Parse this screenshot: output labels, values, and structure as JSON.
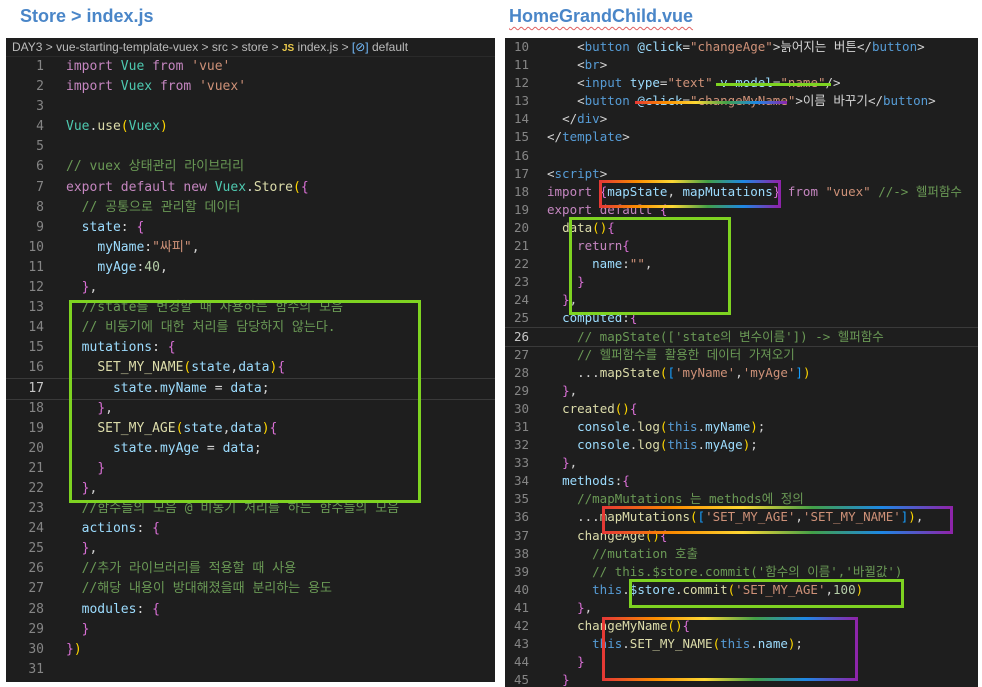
{
  "headings": {
    "left": "Store > index.js",
    "right": "HomeGrandChild.vue"
  },
  "breadcrumb": {
    "folder1": "DAY3",
    "folder2": "vue-starting-template-vuex",
    "folder3": "src",
    "folder4": "store",
    "js_badge": "JS",
    "file": "index.js",
    "symbol_badge": "[⊘]",
    "symbol": "default"
  },
  "colors": {
    "editor_bg": "#1e1e1e",
    "box_green": "#7ed321",
    "heading_blue": "#4a86c8"
  },
  "left_lines": [
    {
      "n": "1",
      "t": "import Vue from 'vue'"
    },
    {
      "n": "2",
      "t": "import Vuex from 'vuex'"
    },
    {
      "n": "3",
      "t": ""
    },
    {
      "n": "4",
      "t": "Vue.use(Vuex)"
    },
    {
      "n": "5",
      "t": ""
    },
    {
      "n": "6",
      "t": "// vuex 상태관리 라이브러리"
    },
    {
      "n": "7",
      "t": "export default new Vuex.Store({"
    },
    {
      "n": "8",
      "t": "  // 공통으로 관리할 데이터"
    },
    {
      "n": "9",
      "t": "  state: {"
    },
    {
      "n": "10",
      "t": "    myName:\"싸피\","
    },
    {
      "n": "11",
      "t": "    myAge:40,"
    },
    {
      "n": "12",
      "t": "  },"
    },
    {
      "n": "13",
      "t": "  //state를 변경할 때 사용하는 함수의 모음"
    },
    {
      "n": "14",
      "t": "  // 비동기에 대한 처리를 담당하지 않는다."
    },
    {
      "n": "15",
      "t": "  mutations: {"
    },
    {
      "n": "16",
      "t": "    SET_MY_NAME(state,data){"
    },
    {
      "n": "17",
      "t": "      state.myName = data;"
    },
    {
      "n": "18",
      "t": "    },"
    },
    {
      "n": "19",
      "t": "    SET_MY_AGE(state,data){"
    },
    {
      "n": "20",
      "t": "      state.myAge = data;"
    },
    {
      "n": "21",
      "t": "    }"
    },
    {
      "n": "22",
      "t": "  },"
    },
    {
      "n": "23",
      "t": "  //함수들의 모음 @ 비동기 처리를 하는 함수들의 모음"
    },
    {
      "n": "24",
      "t": "  actions: {"
    },
    {
      "n": "25",
      "t": "  },"
    },
    {
      "n": "26",
      "t": "  //추가 라이브러리를 적용할 때 사용"
    },
    {
      "n": "27",
      "t": "  //해당 내용이 방대해졌을때 분리하는 용도"
    },
    {
      "n": "28",
      "t": "  modules: {"
    },
    {
      "n": "29",
      "t": "  }"
    },
    {
      "n": "30",
      "t": "})"
    },
    {
      "n": "31",
      "t": ""
    }
  ],
  "right_lines": [
    {
      "n": "10",
      "t": "    <button @click=\"changeAge\">늙어지는 버튼</button>"
    },
    {
      "n": "11",
      "t": "    <br>"
    },
    {
      "n": "12",
      "t": "    <input type=\"text\" v-model=\"name\"/>"
    },
    {
      "n": "13",
      "t": "    <button @click=\"changeMyName\">이름 바꾸기</button>"
    },
    {
      "n": "14",
      "t": "  </div>"
    },
    {
      "n": "15",
      "t": "</template>"
    },
    {
      "n": "16",
      "t": ""
    },
    {
      "n": "17",
      "t": "<script>"
    },
    {
      "n": "18",
      "t": "import {mapState, mapMutations} from \"vuex\" //-> 헬퍼함수"
    },
    {
      "n": "19",
      "t": "export default {"
    },
    {
      "n": "20",
      "t": "  data(){"
    },
    {
      "n": "21",
      "t": "    return{"
    },
    {
      "n": "22",
      "t": "      name:\"\","
    },
    {
      "n": "23",
      "t": "    }"
    },
    {
      "n": "24",
      "t": "  },"
    },
    {
      "n": "25",
      "t": "  computed:{"
    },
    {
      "n": "26",
      "t": "    // mapState(['state의 변수이름']) -> 헬퍼함수"
    },
    {
      "n": "27",
      "t": "    // 헬퍼함수를 활용한 데이터 가져오기"
    },
    {
      "n": "28",
      "t": "    ...mapState(['myName','myAge'])"
    },
    {
      "n": "29",
      "t": "  },"
    },
    {
      "n": "30",
      "t": "  created(){"
    },
    {
      "n": "31",
      "t": "    console.log(this.myName);"
    },
    {
      "n": "32",
      "t": "    console.log(this.myAge);"
    },
    {
      "n": "33",
      "t": "  },"
    },
    {
      "n": "34",
      "t": "  methods:{"
    },
    {
      "n": "35",
      "t": "    //mapMutations 는 methods에 정의"
    },
    {
      "n": "36",
      "t": "    ...mapMutations(['SET_MY_AGE','SET_MY_NAME']),"
    },
    {
      "n": "37",
      "t": "    changeAge(){"
    },
    {
      "n": "38",
      "t": "      //mutation 호출"
    },
    {
      "n": "39",
      "t": "      // this.$store.commit('함수의 이름','바뀔값')"
    },
    {
      "n": "40",
      "t": "      this.$store.commit('SET_MY_AGE',100)"
    },
    {
      "n": "41",
      "t": "    },"
    },
    {
      "n": "42",
      "t": "    changeMyName(){"
    },
    {
      "n": "43",
      "t": "      this.SET_MY_NAME(this.name);"
    },
    {
      "n": "44",
      "t": "    }"
    },
    {
      "n": "45",
      "t": "  }"
    }
  ]
}
